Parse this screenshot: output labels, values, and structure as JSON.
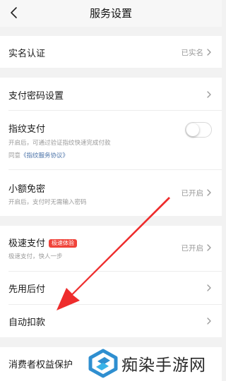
{
  "header": {
    "title": "服务设置",
    "back_icon": "chevron-left-icon"
  },
  "rows": {
    "realname": {
      "label": "实名认证",
      "status": "已实名"
    },
    "paypwd": {
      "label": "支付密码设置"
    },
    "fingerprint": {
      "label": "指纹支付",
      "desc": "开启后，可通过验证指纹快速完成付款",
      "agree_prefix": "同意",
      "agree_link": "《指纹服务协议》",
      "enabled": false
    },
    "smallfree": {
      "label": "小额免密",
      "desc": "开启后，支付时无需输入密码",
      "status": "已开启"
    },
    "fastpay": {
      "label": "极速支付",
      "badge": "极速体验",
      "desc": "极速支付，快人一步",
      "status": "已开启"
    },
    "paylater": {
      "label": "先用后付"
    },
    "autodeduct": {
      "label": "自动扣款"
    },
    "consumer": {
      "label": "消费者权益保护"
    }
  },
  "annotation": {
    "arrow_color": "#ee2c2c"
  },
  "watermark": {
    "text": "痴染手游网"
  }
}
